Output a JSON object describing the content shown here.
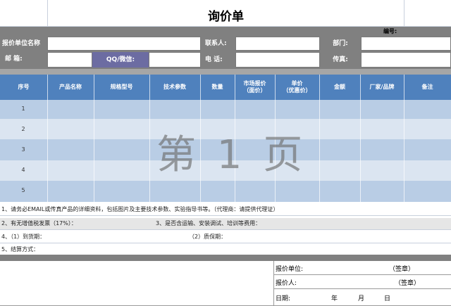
{
  "form": {
    "title": "询价单",
    "number_label": "编号:",
    "quoting_unit_label": "报价单位名称",
    "contact_label": "联系人:",
    "dept_label": "部门:",
    "email_label": "邮    箱:",
    "qq_label": "QQ/微信:",
    "phone_label": "电  话:",
    "fax_label": "传真:"
  },
  "table": {
    "headers": [
      {
        "l1": "序号",
        "l2": ""
      },
      {
        "l1": "产品名称",
        "l2": ""
      },
      {
        "l1": "规格型号",
        "l2": ""
      },
      {
        "l1": "技术参数",
        "l2": ""
      },
      {
        "l1": "数量",
        "l2": ""
      },
      {
        "l1": "市场报价",
        "l2": "（面价）"
      },
      {
        "l1": "单价",
        "l2": "（优惠价）"
      },
      {
        "l1": "金额",
        "l2": ""
      },
      {
        "l1": "厂家/品牌",
        "l2": ""
      },
      {
        "l1": "备注",
        "l2": ""
      }
    ],
    "rows": [
      "1",
      "2",
      "3",
      "4",
      "5"
    ]
  },
  "watermark": "第 1 页",
  "notes": {
    "n1": "1、请务必EMAIL或传真产品的详细资料，包括图片及主要技术参数、实验指导书等。（代理商：请提供代理证）",
    "n2": "2、有无增值税发票（17%）：",
    "n3": "3、是否含运输、安装调试、培训等费用：",
    "n4a": "4、（1）到货期：",
    "n4b": "（2）质保期：",
    "n5": "5、结算方式："
  },
  "signature": {
    "unit_label": "报价单位:",
    "unit_stamp": "（签章）",
    "person_label": "报价人:",
    "person_stamp": "（签章）",
    "date_label": "日期:",
    "year": "年",
    "month": "月",
    "day": "日"
  }
}
